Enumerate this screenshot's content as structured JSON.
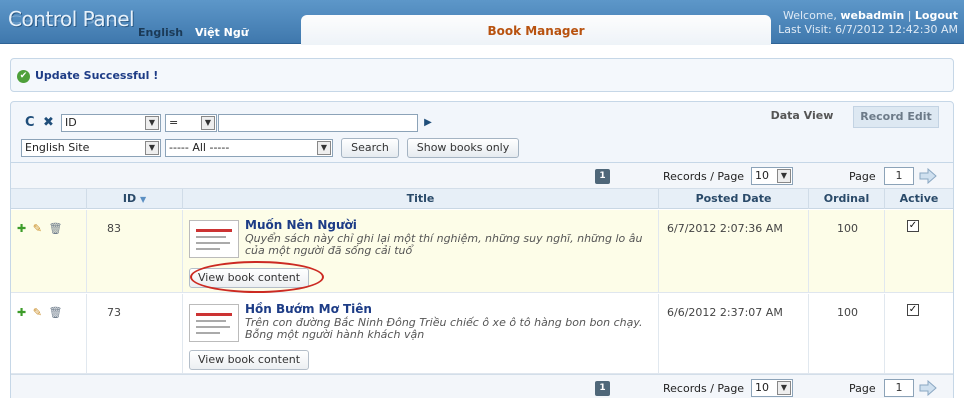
{
  "header": {
    "logo": "Control Panel",
    "lang_en": "English",
    "lang_vi": "Việt Ngữ",
    "app_tab": "Book Manager",
    "welcome_prefix": "Welcome,",
    "username": "webadmin",
    "separator": "|",
    "logout": "Logout",
    "last_visit": "Last Visit: 6/7/2012 12:42:30 AM"
  },
  "message": {
    "text": "Update Successful !"
  },
  "view_tabs": {
    "data_view": "Data View",
    "record_edit": "Record Edit"
  },
  "toolbar": {
    "field_select": "ID",
    "operator_select": "=",
    "filter_value": "",
    "site_select": "English Site",
    "category_select": "----- All -----",
    "search_button": "Search",
    "show_books_button": "Show books only"
  },
  "pager": {
    "current_page_badge": "1",
    "records_per_page_label": "Records / Page",
    "records_per_page_value": "10",
    "page_label": "Page",
    "page_value": "1"
  },
  "columns": {
    "id": "ID",
    "id_sort_icon": "▼",
    "title": "Title",
    "posted_date": "Posted Date",
    "ordinal": "Ordinal",
    "active": "Active"
  },
  "rows": [
    {
      "id": "83",
      "title": "Muốn Nên Người",
      "description": "Quyển sách này chỉ ghi lại một thí nghiệm, những suy nghĩ, những lo âu của một người đã sống cải tuổ",
      "view_button": "View book content",
      "posted_date": "6/7/2012 2:07:36 AM",
      "ordinal": "100",
      "active": true
    },
    {
      "id": "73",
      "title": "Hồn Bướm Mơ Tiên",
      "description": "Trên con đường Bắc Ninh Đông Triều chiếc ô xe ô tô hàng bon bon chạy. Bỗng một người hành khách vận",
      "view_button": "View book content",
      "posted_date": "6/6/2012 2:37:07 AM",
      "ordinal": "100",
      "active": true
    }
  ],
  "colors": {
    "header_blue": "#4a86bd",
    "brand_orange": "#b8520f",
    "link_blue": "#1d3c86",
    "highlight_row": "#fdfde8",
    "annotation_red": "#cc2a22"
  }
}
